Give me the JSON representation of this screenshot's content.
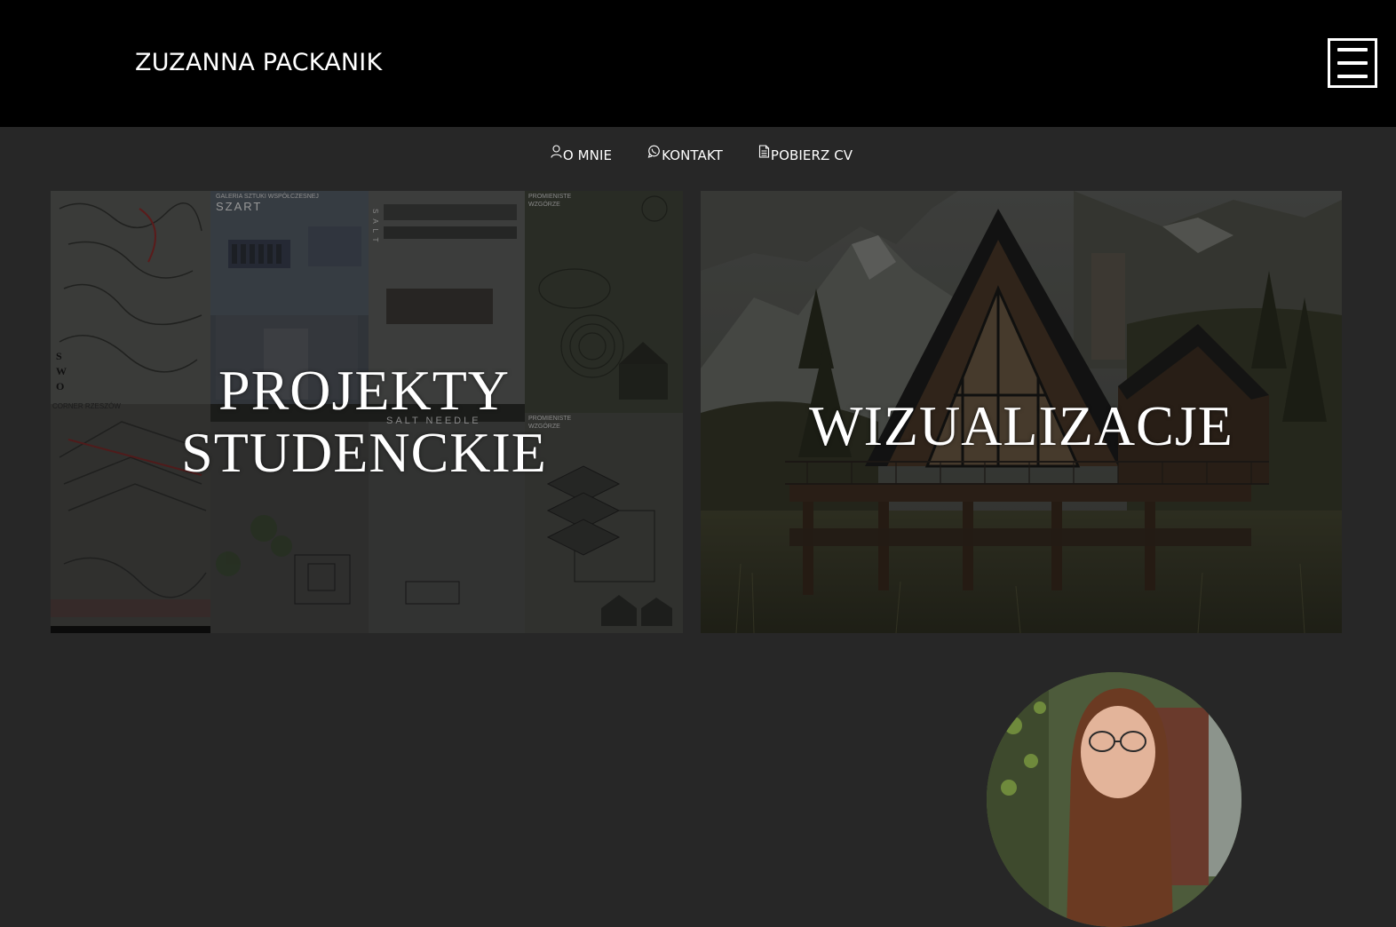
{
  "header": {
    "site_title": "ZUZANNA PACKANIK",
    "menu_icon": "hamburger-menu-icon"
  },
  "subnav": {
    "items": [
      {
        "label": "O MNIE",
        "icon": "user-icon"
      },
      {
        "label": "KONTAKT",
        "icon": "whatsapp-icon"
      },
      {
        "label": "POBIERZ CV",
        "icon": "document-icon"
      }
    ]
  },
  "tiles": {
    "student_projects": {
      "label_line1": "PROJEKTY",
      "label_line2": "STUDENCKIE"
    },
    "visualizations": {
      "label": "WIZUALIZACJE"
    }
  },
  "poster_texts": {
    "gallery": "GALERIA SZTUKI WSPÓŁCZESNEJ",
    "szart": "SZART",
    "salt_needle": "SALT NEEDLE",
    "salt_vertical": "SALT",
    "promieniste1": "PROMIENISTE WZGÓRZE",
    "promieniste2": "PROMIENISTE WZGÓRZE",
    "swot": "SWOT",
    "corner": "CORNER RZESZÓW"
  },
  "colors": {
    "page_bg": "#272727",
    "header_bg": "#000000",
    "text": "#ffffff"
  }
}
